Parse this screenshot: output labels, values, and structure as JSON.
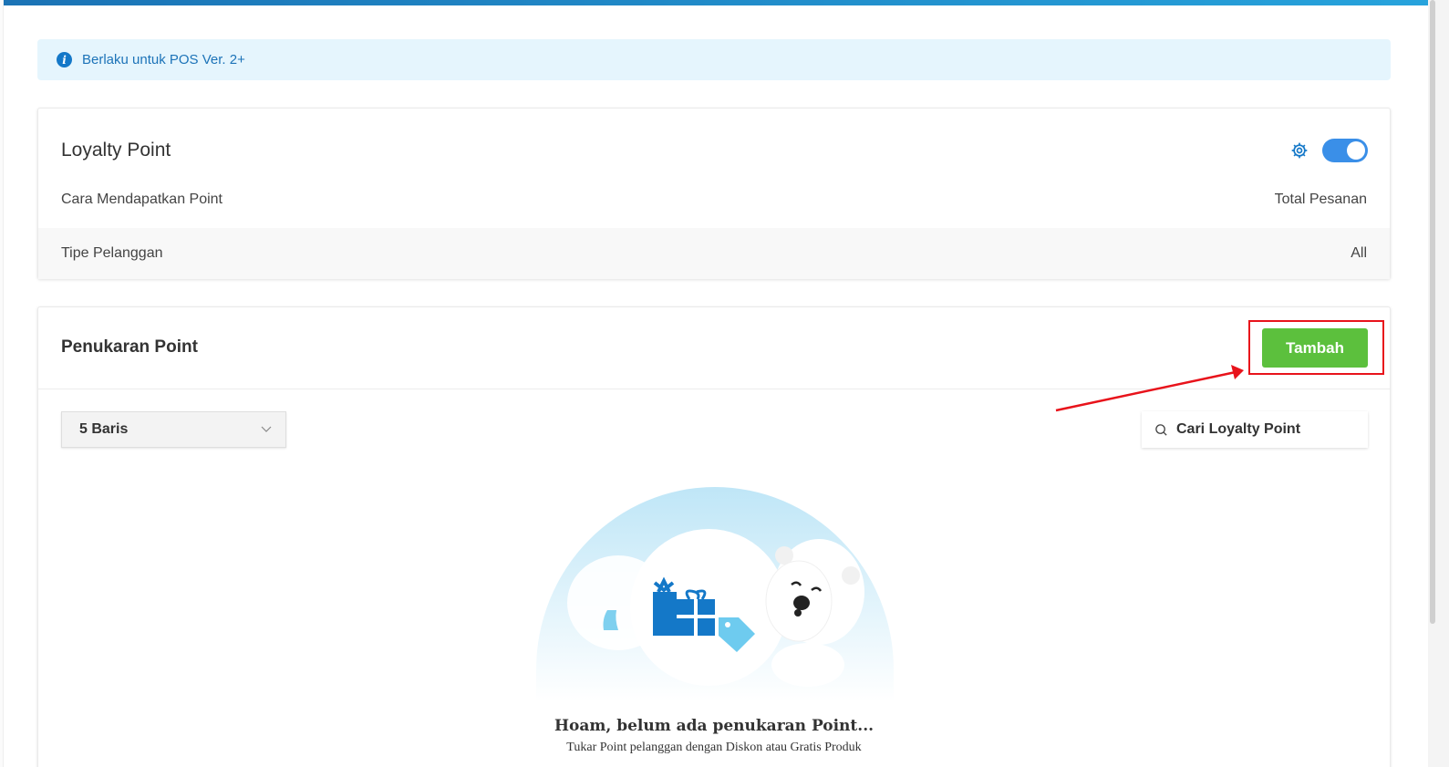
{
  "info_banner": {
    "text": "Berlaku untuk POS Ver. 2+",
    "icon": "info-icon"
  },
  "loyalty": {
    "title": "Loyalty Point",
    "toggle_on": true,
    "rows": [
      {
        "label": "Cara Mendapatkan Point",
        "value": "Total Pesanan"
      },
      {
        "label": "Tipe Pelanggan",
        "value": "All"
      }
    ]
  },
  "penukaran": {
    "title": "Penukaran Point",
    "add_button": "Tambah",
    "rows_select": "5 Baris",
    "search_placeholder": "Cari Loyalty Point",
    "empty_title": "Hoam, belum ada penukaran Point...",
    "empty_subtitle": "Tukar Point pelanggan dengan Diskon atau Gratis Produk"
  },
  "colors": {
    "accent": "#1478c8",
    "success": "#5cc03d",
    "highlight": "#e8131b",
    "banner_bg": "#e5f5fd"
  }
}
